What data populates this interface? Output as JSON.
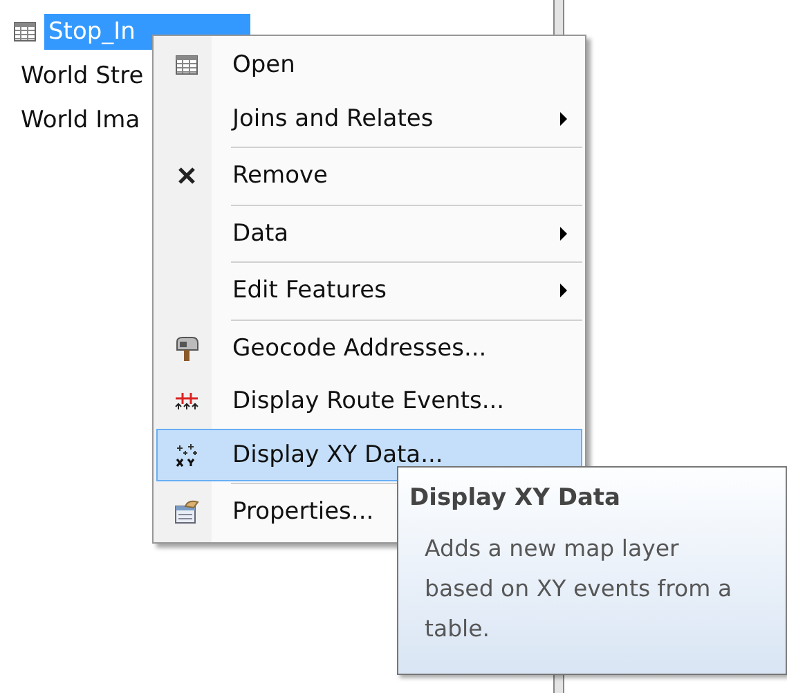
{
  "layers": [
    {
      "label": "Stop_In",
      "selected": true
    },
    {
      "label": "World Stre",
      "selected": false
    },
    {
      "label": "World Ima",
      "selected": false
    }
  ],
  "context_menu": {
    "items": [
      {
        "label": "Open",
        "submenu": false,
        "selected": false,
        "separator_after": false
      },
      {
        "label": "Joins and Relates",
        "submenu": true,
        "selected": false,
        "separator_after": true
      },
      {
        "label": "Remove",
        "submenu": false,
        "selected": false,
        "separator_after": true
      },
      {
        "label": "Data",
        "submenu": true,
        "selected": false,
        "separator_after": true
      },
      {
        "label": "Edit Features",
        "submenu": true,
        "selected": false,
        "separator_after": true
      },
      {
        "label": "Geocode Addresses...",
        "submenu": false,
        "selected": false,
        "separator_after": false
      },
      {
        "label": "Display Route Events...",
        "submenu": false,
        "selected": false,
        "separator_after": false
      },
      {
        "label": "Display XY Data...",
        "submenu": false,
        "selected": true,
        "separator_after": true
      },
      {
        "label": "Properties...",
        "submenu": false,
        "selected": false,
        "separator_after": false
      }
    ]
  },
  "tooltip": {
    "title": "Display XY Data",
    "description": "Adds a new map layer based on XY events from a table."
  }
}
